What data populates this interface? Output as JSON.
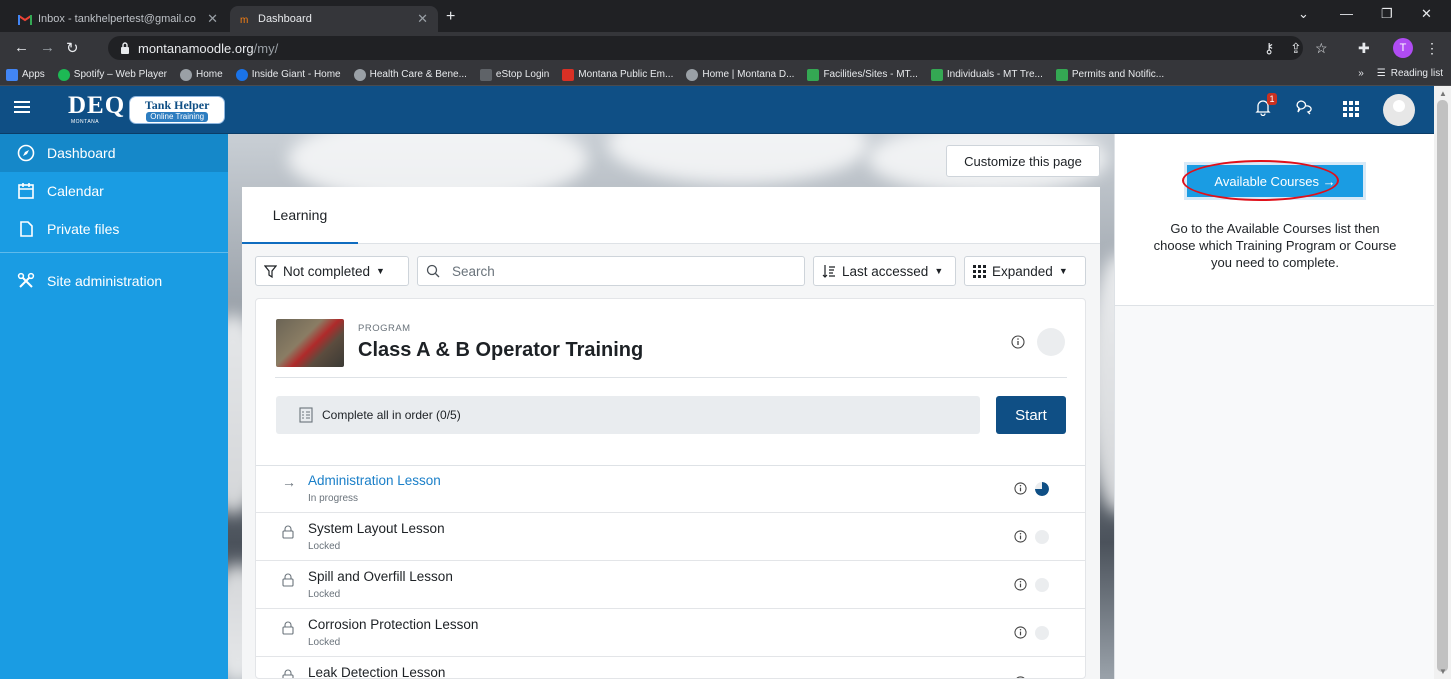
{
  "browser": {
    "tabs": [
      {
        "title": "Inbox - tankhelpertest@gmail.co",
        "close": "✕",
        "favicon_color": "#ea4335"
      },
      {
        "title": "Dashboard",
        "close": "✕",
        "favicon_color": "#f98012"
      }
    ],
    "new_tab": "+",
    "url_host": "montanamoodle.org",
    "url_path": "/my/",
    "profile_initial": "T",
    "bookmarks": [
      {
        "label": "Apps",
        "color": "#4285f4"
      },
      {
        "label": "Spotify – Web Player",
        "color": "#1db954"
      },
      {
        "label": "Home",
        "color": "#9aa0a6"
      },
      {
        "label": "Inside Giant - Home",
        "color": "#1a73e8"
      },
      {
        "label": "Health Care & Bene...",
        "color": "#9aa0a6"
      },
      {
        "label": "eStop Login",
        "color": "#5f6368"
      },
      {
        "label": "Montana Public Em...",
        "color": "#d93025"
      },
      {
        "label": "Home | Montana D...",
        "color": "#9aa0a6"
      },
      {
        "label": "Facilities/Sites - MT...",
        "color": "#34a853"
      },
      {
        "label": "Individuals - MT Tre...",
        "color": "#34a853"
      },
      {
        "label": "Permits and Notific...",
        "color": "#34a853"
      }
    ],
    "overflow": "»",
    "reading_list": "Reading list"
  },
  "navbar": {
    "brand": "DEQ",
    "brand_sub": "MONTANA",
    "badge_title": "Tank Helper",
    "badge_sub": "Online Training",
    "notification_count": "1",
    "bg_color": "#0f4f85"
  },
  "sidebar": {
    "items": [
      {
        "label": "Dashboard",
        "icon": "dashboard-icon"
      },
      {
        "label": "Calendar",
        "icon": "calendar-icon"
      },
      {
        "label": "Private files",
        "icon": "file-icon"
      },
      {
        "label": "Site administration",
        "icon": "wrench-icon"
      }
    ],
    "bg_color": "#1a9ce3"
  },
  "main": {
    "customize_label": "Customize this page",
    "tab_label": "Learning",
    "filter_label": "Not completed",
    "search_placeholder": "Search",
    "sort_label": "Last accessed",
    "view_label": "Expanded",
    "program": {
      "kicker": "PROGRAM",
      "title": "Class A & B Operator Training",
      "sequence_label": "Complete all in order (0/5)",
      "start_label": "Start",
      "lessons": [
        {
          "name": "Administration Lesson",
          "status": "In progress",
          "progress": 0.75
        },
        {
          "name": "System Layout Lesson",
          "status": "Locked",
          "progress": 0
        },
        {
          "name": "Spill and Overfill Lesson",
          "status": "Locked",
          "progress": 0
        },
        {
          "name": "Corrosion Protection Lesson",
          "status": "Locked",
          "progress": 0
        },
        {
          "name": "Leak Detection Lesson",
          "status": "",
          "progress": 0
        }
      ]
    }
  },
  "right": {
    "button_label": "Available Courses →",
    "description": "Go to the Available Courses list then choose which Training Program or Course you need to complete."
  }
}
